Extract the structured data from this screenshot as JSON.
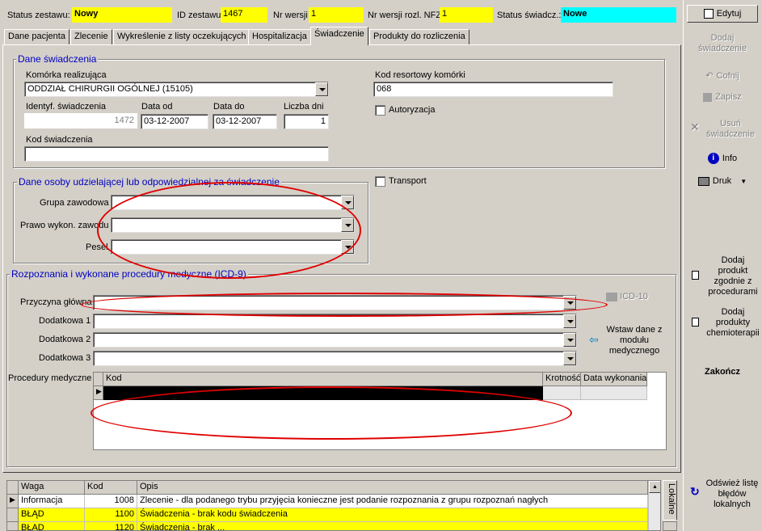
{
  "header": {
    "status_label": "Status zestawu:",
    "status_value": "Nowy",
    "id_label": "ID zestawu",
    "id_value": "1467",
    "nr_wersji_label": "Nr wersji",
    "nr_wersji_value": "1",
    "nr_wersji_nfz_label": "Nr wersji rozl. NFZ",
    "nr_wersji_nfz_value": "1",
    "status_swiad_label": "Status świadcz.:",
    "status_swiad_value": "Nowe"
  },
  "tabs": [
    "Dane pacjenta",
    "Zlecenie",
    "Wykreślenie z listy oczekujących",
    "Hospitalizacja",
    "Świadczenie",
    "Produkty do rozliczenia"
  ],
  "dane_swiadczenia": {
    "legend": "Dane świadczenia",
    "komorka_label": "Komórka realizująca",
    "komorka_value": "ODDZIAŁ CHIRURGII OGÓLNEJ (15105)",
    "kod_resort_label": "Kod resortowy komórki",
    "kod_resort_value": "068",
    "identyf_label": "Identyf. świadczenia",
    "identyf_value": "1472",
    "data_od_label": "Data od",
    "data_od_value": "03-12-2007",
    "data_do_label": "Data do",
    "data_do_value": "03-12-2007",
    "liczba_dni_label": "Liczba dni",
    "liczba_dni_value": "1",
    "autoryzacja_label": "Autoryzacja",
    "kod_swiad_label": "Kod świadczenia",
    "kod_swiad_value": ""
  },
  "osoba": {
    "legend": "Dane osoby udzielającej lub odpowiedzialnej za świadczenie",
    "grupa_label": "Grupa zawodowa",
    "prawo_label": "Prawo wykon. zawodu",
    "pesel_label": "Pesel",
    "transport_label": "Transport"
  },
  "rozpoznania": {
    "legend": "Rozpoznania i wykonane procedury medyczne (ICD-9)",
    "przyczyna_label": "Przyczyna główna",
    "dod1_label": "Dodatkowa 1",
    "dod2_label": "Dodatkowa 2",
    "dod3_label": "Dodatkowa 3",
    "icd10_label": "ICD-10",
    "wstaw_label": "Wstaw dane z modułu medycznego",
    "procedury_label": "Procedury medyczne",
    "proc_columns": [
      "Kod",
      "Krotność",
      "Data wykonania"
    ]
  },
  "errors": {
    "columns": [
      "Waga",
      "Kod",
      "Opis"
    ],
    "rows": [
      {
        "waga": "Informacja",
        "kod": "1008",
        "opis": "Zlecenie - dla podanego trybu przyjęcia konieczne jest podanie rozpoznania z grupu rozpoznań nagłych"
      },
      {
        "waga": "BŁĄD",
        "kod": "1100",
        "opis": "Świadczenia - brak kodu świadczenia"
      },
      {
        "waga": "BŁĄD",
        "kod": "1120",
        "opis": "Świadczenia - brak ..."
      }
    ],
    "side_tab": "Lokalne"
  },
  "toolbar": {
    "edytuj": "Edytuj",
    "dodaj_swiad": "Dodaj świadczenie",
    "cofnij": "Cofnij",
    "zapisz": "Zapisz",
    "usun_swiad": "Usuń świadczenie",
    "info": "Info",
    "druk": "Druk",
    "dodaj_produkt": "Dodaj produkt zgodnie z procedurami",
    "dodaj_chemio": "Dodaj produkty chemioterapii",
    "zakoncz": "Zakończ",
    "odswiez": "Odśwież listę błędów lokalnych"
  }
}
